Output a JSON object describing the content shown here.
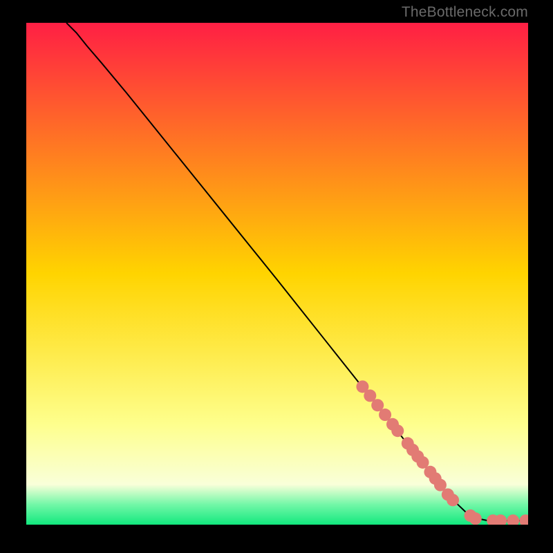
{
  "watermark": "TheBottleneck.com",
  "colors": {
    "gradient_top": "#ff1f44",
    "gradient_mid": "#ffd400",
    "gradient_yellow_pale": "#feff8d",
    "gradient_cream": "#f9ffd9",
    "gradient_green_light": "#72f7a7",
    "gradient_green": "#12e87e",
    "curve": "#000000",
    "marker": "#e27b74",
    "frame": "#000000"
  },
  "chart_data": {
    "type": "line",
    "title": "",
    "xlabel": "",
    "ylabel": "",
    "xlim": [
      0,
      100
    ],
    "ylim": [
      0,
      100
    ],
    "curve": {
      "x": [
        8,
        10,
        12,
        15,
        20,
        25,
        30,
        35,
        40,
        45,
        50,
        55,
        60,
        65,
        70,
        75,
        80,
        83,
        86,
        88,
        90,
        92,
        94,
        96,
        98,
        100
      ],
      "y": [
        100,
        98,
        95.5,
        92,
        86,
        79.8,
        73.6,
        67.4,
        61.2,
        55,
        48.8,
        42.5,
        36.2,
        29.9,
        23.6,
        17.3,
        11,
        7.2,
        4,
        2.1,
        1.2,
        0.8,
        0.8,
        0.8,
        0.8,
        0.8
      ]
    },
    "markers": [
      {
        "x": 67,
        "y": 27.5
      },
      {
        "x": 68.5,
        "y": 25.7
      },
      {
        "x": 70,
        "y": 23.8
      },
      {
        "x": 71.5,
        "y": 21.9
      },
      {
        "x": 73,
        "y": 20.0
      },
      {
        "x": 74,
        "y": 18.7
      },
      {
        "x": 76,
        "y": 16.2
      },
      {
        "x": 77,
        "y": 14.9
      },
      {
        "x": 78,
        "y": 13.6
      },
      {
        "x": 79,
        "y": 12.4
      },
      {
        "x": 80.5,
        "y": 10.5
      },
      {
        "x": 81.5,
        "y": 9.2
      },
      {
        "x": 82.5,
        "y": 7.9
      },
      {
        "x": 84,
        "y": 6.0
      },
      {
        "x": 85,
        "y": 4.9
      },
      {
        "x": 88.5,
        "y": 1.8
      },
      {
        "x": 89.5,
        "y": 1.2
      },
      {
        "x": 93,
        "y": 0.8
      },
      {
        "x": 94.5,
        "y": 0.8
      },
      {
        "x": 97,
        "y": 0.8
      },
      {
        "x": 99.5,
        "y": 0.8
      }
    ]
  }
}
